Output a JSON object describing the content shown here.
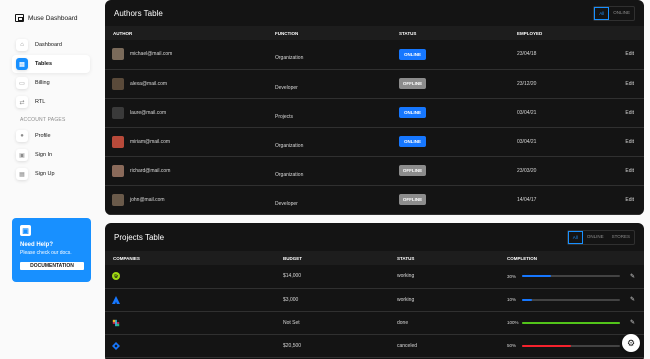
{
  "brand": {
    "name": "Muse Dashboard",
    "icon": "window-icon"
  },
  "sidebar": {
    "items": [
      {
        "label": "Dashboard",
        "icon": "home-icon",
        "glyph": "⌂",
        "active": false
      },
      {
        "label": "Tables",
        "icon": "table-icon",
        "glyph": "▤",
        "active": true
      },
      {
        "label": "Billing",
        "icon": "card-icon",
        "glyph": "▭",
        "active": false
      },
      {
        "label": "RTL",
        "icon": "rtl-icon",
        "glyph": "⇄",
        "active": false
      }
    ],
    "section_label": "ACCOUNT PAGES",
    "account_items": [
      {
        "label": "Profile",
        "icon": "user-icon",
        "glyph": "●"
      },
      {
        "label": "Sign In",
        "icon": "lock-icon",
        "glyph": "▣"
      },
      {
        "label": "Sign Up",
        "icon": "signup-icon",
        "glyph": "▦"
      }
    ]
  },
  "help": {
    "title": "Need Help?",
    "subtitle": "Please check our docs.",
    "button": "DOCUMENTATION"
  },
  "authors_table": {
    "title": "Authors Table",
    "filters": [
      "All",
      "ONLINE"
    ],
    "columns": [
      "AUTHOR",
      "FUNCTION",
      "STATUS",
      "EMPLOYED",
      ""
    ],
    "rows": [
      {
        "email": "michael@mail.com",
        "function": "Organization",
        "status": "ONLINE",
        "online": true,
        "employed": "23/04/18",
        "action": "Edit",
        "avatar_color": "#7a6a5a"
      },
      {
        "email": "alexa@mail.com",
        "function": "Developer",
        "status": "OFFLINE",
        "online": false,
        "employed": "23/12/20",
        "action": "Edit",
        "avatar_color": "#5a4a3a"
      },
      {
        "email": "laure@mail.com",
        "function": "Projects",
        "status": "ONLINE",
        "online": true,
        "employed": "03/04/21",
        "action": "Edit",
        "avatar_color": "#3a3a3a"
      },
      {
        "email": "miriam@mail.com",
        "function": "Organization",
        "status": "ONLINE",
        "online": true,
        "employed": "03/04/21",
        "action": "Edit",
        "avatar_color": "#b84a3a"
      },
      {
        "email": "richard@mail.com",
        "function": "Organization",
        "status": "OFFLINE",
        "online": false,
        "employed": "23/03/20",
        "action": "Edit",
        "avatar_color": "#8a6a5a"
      },
      {
        "email": "john@mail.com",
        "function": "Developer",
        "status": "OFFLINE",
        "online": false,
        "employed": "14/04/17",
        "action": "Edit",
        "avatar_color": "#6a5a4a"
      }
    ]
  },
  "projects_table": {
    "title": "Projects Table",
    "filters": [
      "All",
      "ONLINE",
      "STORES"
    ],
    "columns": [
      "COMPANIES",
      "BUDGET",
      "STATUS",
      "COMPLETION"
    ],
    "rows": [
      {
        "icon": "spotify-icon",
        "icon_color": "#a0d911",
        "budget": "$14,000",
        "status": "working",
        "completion_label": "30%",
        "completion": 0.3,
        "bar_color": "#1677ff"
      },
      {
        "icon": "atlassian-icon",
        "icon_color": "#1677ff",
        "budget": "$3,000",
        "status": "working",
        "completion_label": "10%",
        "completion": 0.1,
        "bar_color": "#1677ff"
      },
      {
        "icon": "slack-icon",
        "icon_color": "#e01e5a",
        "budget": "Not Set",
        "status": "done",
        "completion_label": "100%",
        "completion": 1.0,
        "bar_color": "#52c41a"
      },
      {
        "icon": "jira-icon",
        "icon_color": "#1677ff",
        "budget": "$20,500",
        "status": "canceled",
        "completion_label": "50%",
        "completion": 0.5,
        "bar_color": "#f5222d"
      }
    ]
  },
  "settings_button": {
    "icon": "gear-icon"
  }
}
